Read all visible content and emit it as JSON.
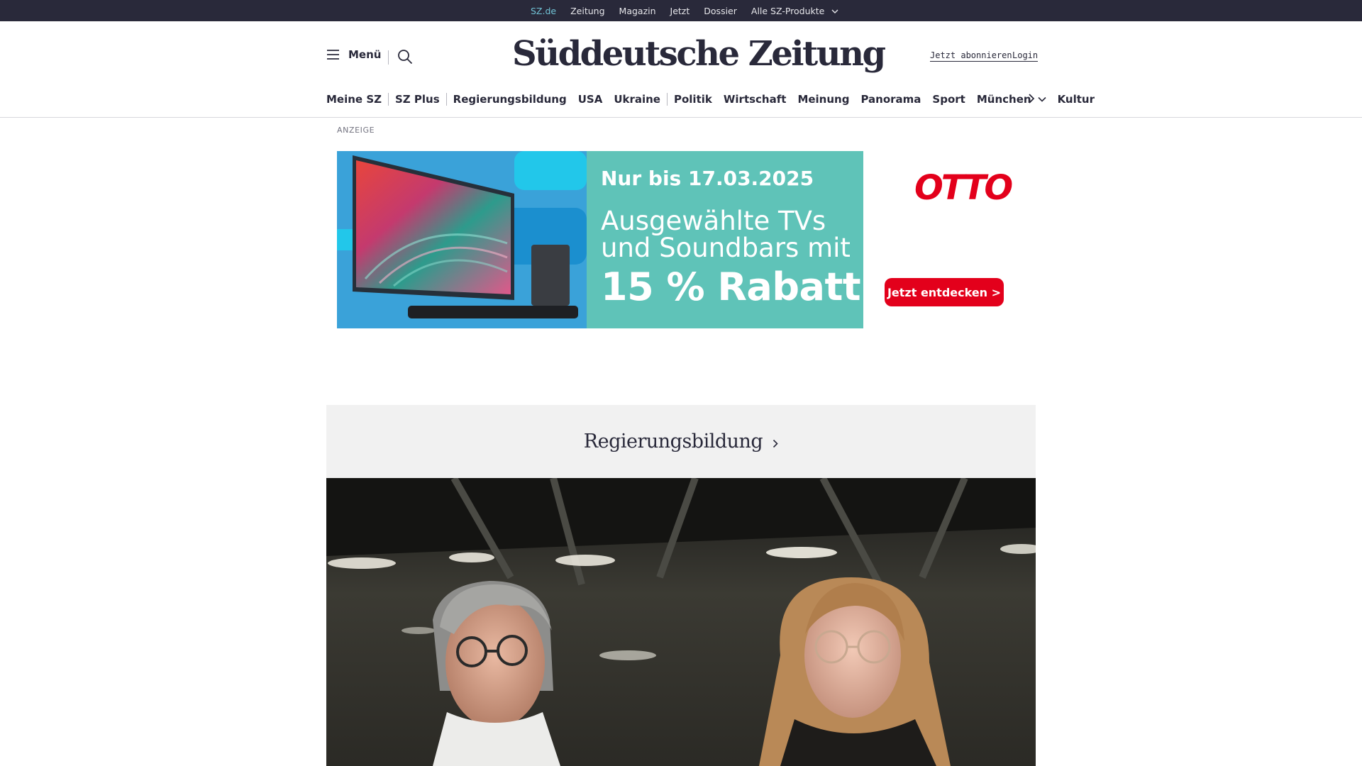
{
  "topbar": {
    "items": [
      {
        "label": "SZ.de",
        "active": true
      },
      {
        "label": "Zeitung",
        "active": false
      },
      {
        "label": "Magazin",
        "active": false
      },
      {
        "label": "Jetzt",
        "active": false
      },
      {
        "label": "Dossier",
        "active": false
      },
      {
        "label": "Alle SZ-Produkte",
        "active": false,
        "has_dropdown": true
      }
    ],
    "background": "#29293a",
    "active_color": "#71c3d6"
  },
  "header": {
    "menu_label": "Menü",
    "menu_icon": "hamburger-icon",
    "search_icon": "search-icon",
    "logo_text": "Süddeutsche Zeitung",
    "subscribe_label": "Jetzt abonnieren",
    "login_label": "Login"
  },
  "section_nav": {
    "items": [
      {
        "label": "Meine SZ"
      },
      {
        "label": "SZ Plus"
      },
      {
        "label": "Regierungsbildung"
      },
      {
        "label": "USA"
      },
      {
        "label": "Ukraine"
      },
      {
        "label": "Politik"
      },
      {
        "label": "Wirtschaft"
      },
      {
        "label": "Meinung"
      },
      {
        "label": "Panorama"
      },
      {
        "label": "Sport"
      },
      {
        "label": "München",
        "has_dropdown": true
      },
      {
        "label": "Kultur"
      }
    ],
    "more_icon": "chevron-right-icon"
  },
  "ad": {
    "label": "ANZEIGE",
    "date_text": "Nur bis 17.03.2025",
    "headline_line1": "Ausgewählte TVs",
    "headline_line2": "und Soundbars mit",
    "discount_text": "15 % Rabatt",
    "brand": "OTTO",
    "cta_label": "Jetzt entdecken >",
    "teal_color": "#5fc3b8",
    "brand_color": "#e3001b"
  },
  "topic": {
    "title": "Regierungsbildung"
  }
}
